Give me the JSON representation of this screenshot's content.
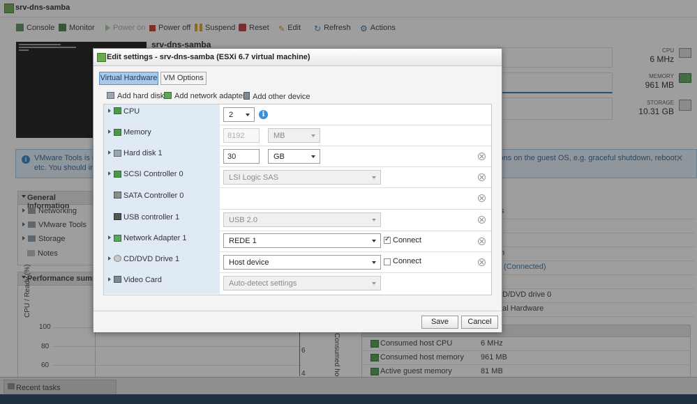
{
  "window": {
    "title": "srv-dns-samba"
  },
  "toolbar": {
    "console": "Console",
    "monitor": "Monitor",
    "power_on": "Power on",
    "power_off": "Power off",
    "suspend": "Suspend",
    "reset": "Reset",
    "edit": "Edit",
    "refresh": "Refresh",
    "actions": "Actions"
  },
  "vm_header": {
    "name": "srv-dns-samba"
  },
  "resources": {
    "cpu_label": "CPU",
    "cpu_value": "6 MHz",
    "memory_label": "MEMORY",
    "memory_value": "961 MB",
    "storage_label": "STORAGE",
    "storage_value": "10.31 GB"
  },
  "banner": {
    "line1": "VMware Tools is not",
    "line2": "etc. You should inst",
    "line1_right": "ions on the guest OS, e.g. graceful shutdown, reboot,"
  },
  "general_info": {
    "title": "General Information",
    "items": [
      "Networking",
      "VMware Tools",
      "Storage",
      "Notes"
    ]
  },
  "perf": {
    "title": "Performance summar",
    "ylabel": "CPU / Ready (%)",
    "yticks": [
      "100",
      "80",
      "60"
    ],
    "right_tick_6": "6",
    "right_tick_4": "4",
    "right_label": "Consumed host"
  },
  "right_fragments": {
    "r1": "s",
    "r2": "n",
    "r3": "(Connected)",
    "r4": "D/DVD drive 0",
    "r5": "al Hardware"
  },
  "host_table": {
    "rows": [
      {
        "label": "Consumed host CPU",
        "value": "6 MHz"
      },
      {
        "label": "Consumed host memory",
        "value": "961 MB"
      },
      {
        "label": "Active guest memory",
        "value": "81 MB"
      }
    ]
  },
  "recent_tasks": "Recent tasks",
  "dialog": {
    "title": "Edit settings - srv-dns-samba (ESXi 6.7 virtual machine)",
    "tabs": [
      "Virtual Hardware",
      "VM Options"
    ],
    "add_hard_disk": "Add hard disk",
    "add_network_adapter": "Add network adapter",
    "add_other_device": "Add other device",
    "rows": {
      "cpu": {
        "label": "CPU",
        "value": "2"
      },
      "memory": {
        "label": "Memory",
        "value": "8192",
        "unit": "MB"
      },
      "hard_disk": {
        "label": "Hard disk 1",
        "value": "30",
        "unit": "GB"
      },
      "scsi": {
        "label": "SCSI Controller 0",
        "value": "LSI Logic SAS"
      },
      "sata": {
        "label": "SATA Controller 0"
      },
      "usb": {
        "label": "USB controller 1",
        "value": "USB 2.0"
      },
      "net": {
        "label": "Network Adapter 1",
        "value": "REDE 1",
        "connect": "Connect",
        "connected": true
      },
      "cd": {
        "label": "CD/DVD Drive 1",
        "value": "Host device",
        "connect": "Connect",
        "connected": false
      },
      "video": {
        "label": "Video Card",
        "value": "Auto-detect settings"
      }
    },
    "save": "Save",
    "cancel": "Cancel"
  }
}
